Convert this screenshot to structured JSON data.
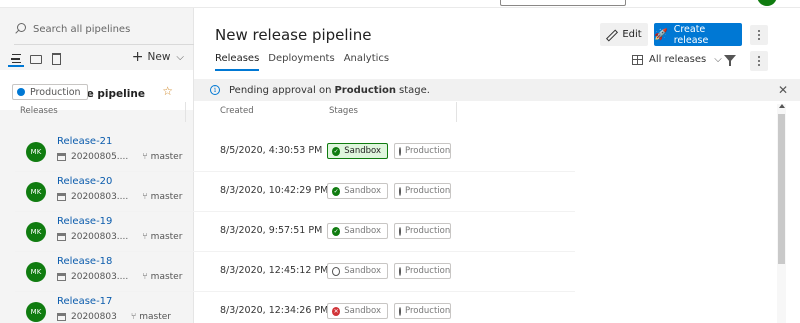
{
  "sidebar": {
    "search_placeholder": "Search all pipelines",
    "new_label": "New",
    "selected_pipeline": {
      "title": "New release pipeline",
      "stage": "Production"
    }
  },
  "header": {
    "title": "New release pipeline",
    "edit_label": "Edit",
    "create_label": "Create release"
  },
  "tabs": [
    {
      "label": "Releases",
      "active": true
    },
    {
      "label": "Deployments",
      "active": false
    },
    {
      "label": "Analytics",
      "active": false
    }
  ],
  "filter_label": "All releases",
  "banner": {
    "prefix": "Pending approval on",
    "bold": "Production",
    "suffix": "stage."
  },
  "table": {
    "columns": [
      "Releases",
      "Created",
      "Stages"
    ],
    "rows": [
      {
        "avatar": "MK",
        "name": "Release-21",
        "build": "20200805....",
        "branch": "master",
        "created": "8/5/2020, 4:30:53 PM",
        "stages": [
          {
            "name": "Sandbox",
            "status": "succeeded",
            "selected": true
          },
          {
            "name": "Production",
            "status": "pending"
          }
        ]
      },
      {
        "avatar": "MK",
        "name": "Release-20",
        "build": "20200803....",
        "branch": "master",
        "created": "8/3/2020, 10:42:29 PM",
        "stages": [
          {
            "name": "Sandbox",
            "status": "succeeded"
          },
          {
            "name": "Production",
            "status": "pending"
          }
        ]
      },
      {
        "avatar": "MK",
        "name": "Release-19",
        "build": "20200803....",
        "branch": "master",
        "created": "8/3/2020, 9:57:51 PM",
        "stages": [
          {
            "name": "Sandbox",
            "status": "succeeded"
          },
          {
            "name": "Production",
            "status": "pending"
          }
        ]
      },
      {
        "avatar": "MK",
        "name": "Release-18",
        "build": "20200803....",
        "branch": "master",
        "created": "8/3/2020, 12:45:12 PM",
        "stages": [
          {
            "name": "Sandbox",
            "status": "pending"
          },
          {
            "name": "Production",
            "status": "pending"
          }
        ]
      },
      {
        "avatar": "MK",
        "name": "Release-17",
        "build": "20200803",
        "branch": "master",
        "created": "8/3/2020, 12:34:26 PM",
        "stages": [
          {
            "name": "Sandbox",
            "status": "failed"
          },
          {
            "name": "Production",
            "status": "pending"
          }
        ]
      }
    ]
  },
  "colors": {
    "accent": "#0078d4",
    "success": "#107c10",
    "failed": "#d13438",
    "link": "#0b5cad"
  }
}
